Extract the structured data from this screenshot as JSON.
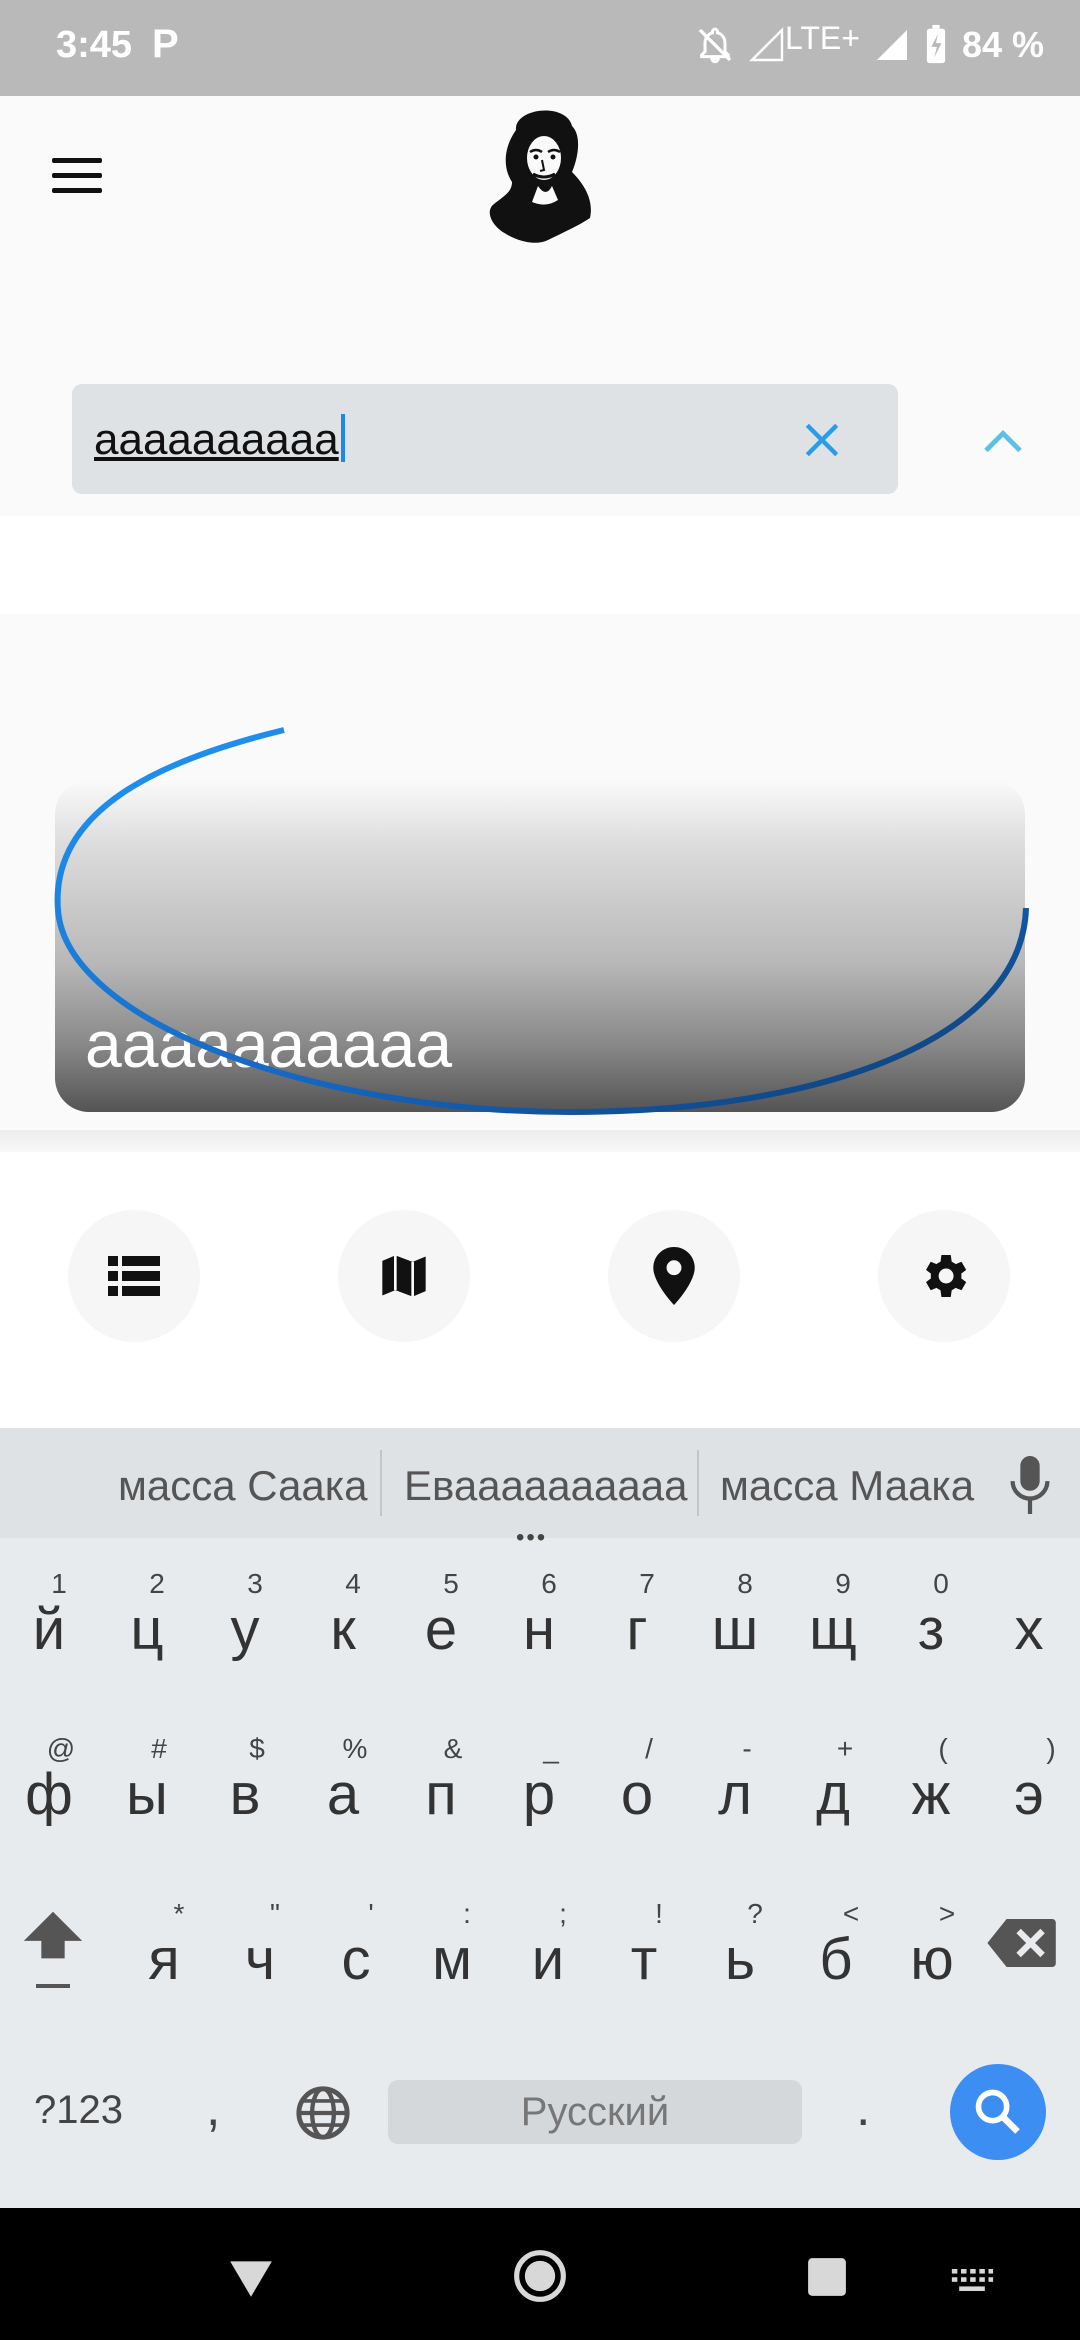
{
  "status_bar": {
    "time": "3:45",
    "parking_glyph": "P",
    "network": "LTE+",
    "battery": "84 %",
    "icons": [
      "parking-icon",
      "notifications-off-icon",
      "signal-empty-icon",
      "signal-icon",
      "battery-charging-icon"
    ]
  },
  "header": {
    "menu_icon": "hamburger-menu-icon",
    "logo_icon": "portrait-logo-icon"
  },
  "search": {
    "value": "aaaaaaaaaa",
    "clear_icon": "close-icon",
    "collapse_icon": "chevron-up-icon"
  },
  "card": {
    "title": "aaaaaaaaaa",
    "loading_icon": "loading-spinner-icon"
  },
  "bottom_nav": [
    {
      "name": "list-icon"
    },
    {
      "name": "map-icon"
    },
    {
      "name": "location-pin-icon"
    },
    {
      "name": "settings-gear-icon"
    }
  ],
  "keyboard": {
    "suggestions": [
      "масса Саака",
      "Еваааааааааа",
      "масса Маака"
    ],
    "row1": {
      "hints": [
        "1",
        "2",
        "3",
        "4",
        "5",
        "6",
        "7",
        "8",
        "9",
        "0",
        ""
      ],
      "keys": [
        "й",
        "ц",
        "у",
        "к",
        "е",
        "н",
        "г",
        "ш",
        "щ",
        "з",
        "х"
      ]
    },
    "row2": {
      "hints": [
        "@",
        "#",
        "$",
        "%",
        "&",
        "_",
        "/",
        "-",
        "+",
        "(",
        ")"
      ],
      "keys": [
        "ф",
        "ы",
        "в",
        "а",
        "п",
        "р",
        "о",
        "л",
        "д",
        "ж",
        "э"
      ]
    },
    "row3": {
      "hints": [
        "*",
        "\"",
        "'",
        ":",
        ";",
        "!",
        "?",
        "<",
        ">"
      ],
      "keys": [
        "я",
        "ч",
        "с",
        "м",
        "и",
        "т",
        "ь",
        "б",
        "ю"
      ]
    },
    "numbers_label": "?123",
    "comma": ",",
    "space_label": "Русский",
    "period": ".",
    "colors": {
      "accent": "#3d8ef2",
      "spinner": "#1e88e5"
    }
  }
}
